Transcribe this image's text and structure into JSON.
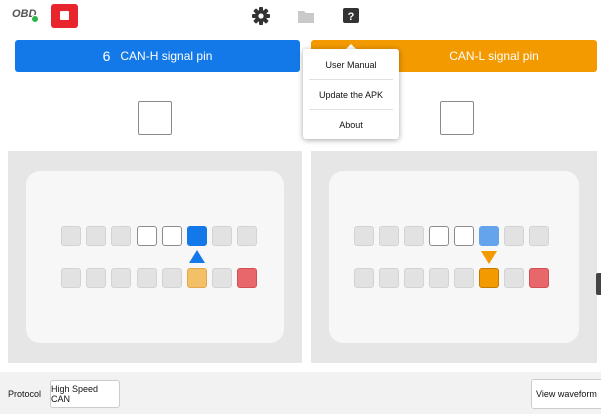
{
  "topbar": {
    "obd_label": "OBD",
    "icons": {
      "obd_status": "green-dot",
      "stop": "stop-icon",
      "settings": "gear-icon",
      "files": "folder-icon",
      "help": "help-icon"
    }
  },
  "channels": {
    "high": {
      "pin_number": "6",
      "label": "CAN-H signal pin",
      "color": "#1479e8"
    },
    "low": {
      "label": "CAN-L signal pin",
      "color": "#f29a00"
    }
  },
  "help_menu": {
    "items": [
      "User Manual",
      "Update the APK",
      "About"
    ]
  },
  "bottombar": {
    "protocol_label": "Protocol",
    "protocol_value": "High Speed CAN",
    "view_waveform": "View waveform"
  },
  "colors": {
    "can_h": "#1479e8",
    "can_h_light": "#64a4ec",
    "can_l": "#f29a00",
    "can_l_light": "#f4c067",
    "ground_pin": "#e8676a",
    "stop": "#e8242c"
  }
}
